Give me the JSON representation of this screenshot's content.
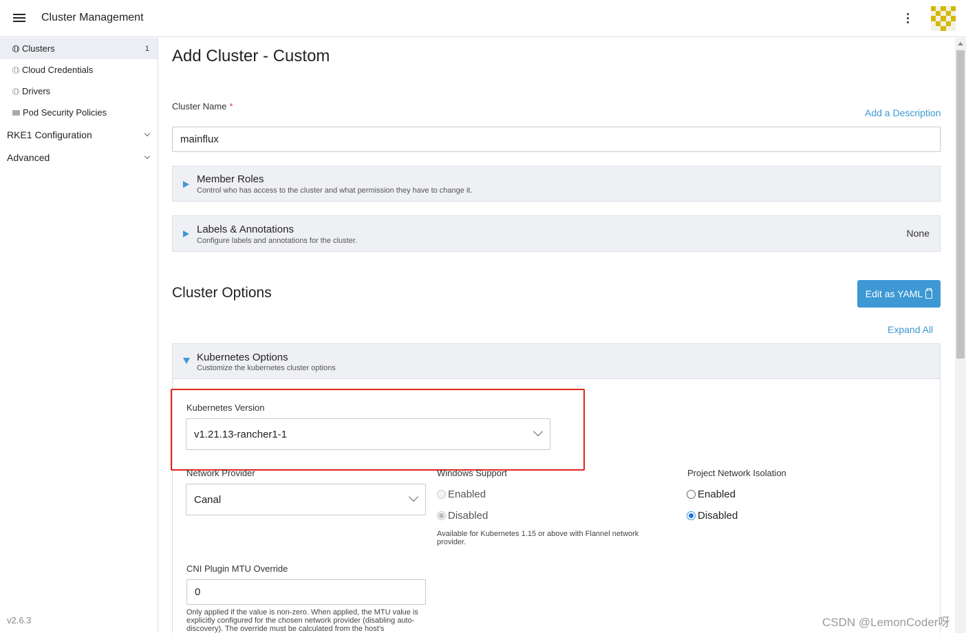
{
  "header": {
    "app_title": "Cluster Management",
    "menu_icon": "hamburger-menu-icon",
    "more_icon": "more-vertical-icon",
    "avatar_icon": "user-avatar-icon",
    "avatar_color": "#d4b800"
  },
  "sidebar": {
    "items": [
      {
        "label": "Clusters",
        "count": "1",
        "icon": "globe-icon",
        "active": true
      },
      {
        "label": "Cloud Credentials",
        "icon": "globe-icon"
      },
      {
        "label": "Drivers",
        "icon": "globe-icon"
      },
      {
        "label": "Pod Security Policies",
        "icon": "folder-icon"
      }
    ],
    "groups": [
      {
        "label": "RKE1 Configuration",
        "icon": "chevron-down-icon"
      },
      {
        "label": "Advanced",
        "icon": "chevron-down-icon"
      }
    ],
    "version": "v2.6.3"
  },
  "main": {
    "title": "Add Cluster - Custom",
    "cluster_name": {
      "label": "Cluster Name",
      "required_mark": "*",
      "value": "mainflux",
      "add_description_link": "Add a Description"
    },
    "member_roles": {
      "title": "Member Roles",
      "description": "Control who has access to the cluster and what permission they have to change it."
    },
    "labels_annotations": {
      "title": "Labels & Annotations",
      "description": "Configure labels and annotations for the cluster.",
      "status": "None"
    },
    "cluster_options": {
      "title": "Cluster Options",
      "edit_yaml_button": "Edit as YAML",
      "expand_all": "Expand All"
    },
    "kubernetes_options": {
      "title": "Kubernetes Options",
      "description": "Customize the kubernetes cluster options",
      "kubernetes_version": {
        "label": "Kubernetes Version",
        "value": "v1.21.13-rancher1-1"
      },
      "network_provider": {
        "label": "Network Provider",
        "value": "Canal"
      },
      "windows_support": {
        "label": "Windows Support",
        "options": [
          "Enabled",
          "Disabled"
        ],
        "selected": "Disabled",
        "disabled": true,
        "help": "Available for Kubernetes 1.15 or above with Flannel network provider."
      },
      "project_network_isolation": {
        "label": "Project Network Isolation",
        "options": [
          "Enabled",
          "Disabled"
        ],
        "selected": "Disabled"
      },
      "cni_mtu": {
        "label": "CNI Plugin MTU Override",
        "value": "0",
        "help": "Only applied if the value is non-zero. When applied, the MTU value is explicitly configured for the chosen network provider (disabling auto-discovery). The override must be calculated from the host's"
      }
    }
  },
  "colors": {
    "accent": "#3d98d3",
    "highlight_border": "#e2231a",
    "panel_bg": "#eff0f4"
  },
  "watermark": "CSDN @LemonCoder呀"
}
